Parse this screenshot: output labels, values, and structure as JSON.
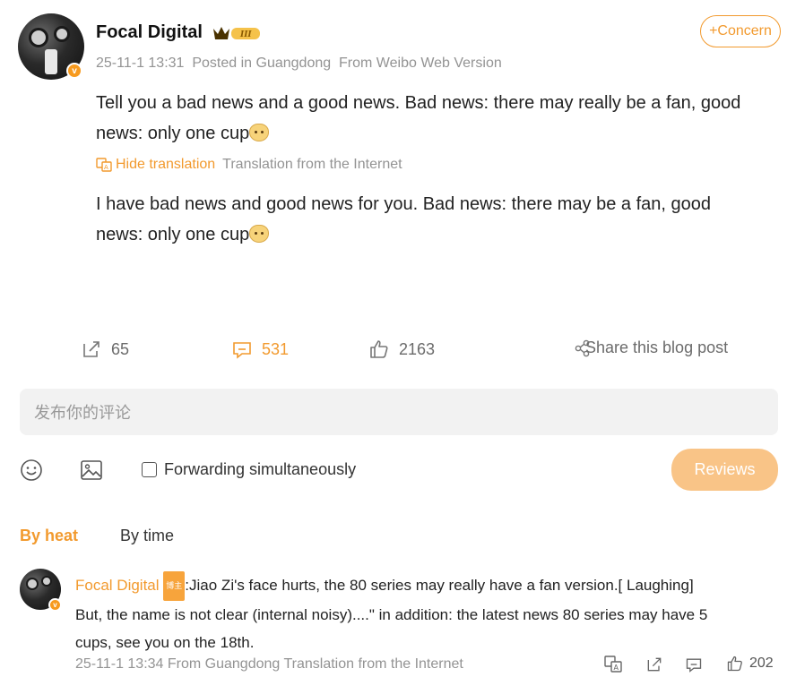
{
  "post": {
    "author": "Focal Digital",
    "timestamp": "25-11-1 13:31",
    "location": "Posted in Guangdong",
    "source": "From Weibo Web Version",
    "follow_label": "+Concern",
    "body_line1": "Tell you a bad news and a good news. Bad news: there may really be a fan, good",
    "body_line2": "news: only one cup",
    "hide_translation": "Hide translation",
    "translation_source": "Translation from the Internet",
    "translated_line1": "I have bad news and good news for you.  Bad news: there may be a fan, good",
    "translated_line2": "news: only one cup"
  },
  "actions": {
    "reposts": "65",
    "comments": "531",
    "likes": "2163",
    "share_label": "Share this blog post"
  },
  "composer": {
    "placeholder": "发布你的评论",
    "forward_label": "Forwarding simultaneously",
    "submit_label": "Reviews"
  },
  "sort": {
    "by_heat": "By heat",
    "by_time": "By time"
  },
  "comment": {
    "author": "Focal Digital",
    "tag": "博主",
    "text_line1": ":Jiao Zi's face hurts, the 80 series may really have a fan version.[ Laughing]",
    "text_line2": "But, the name is not clear (internal noisy)....\" in addition: the latest news 80 series may have 5",
    "text_line3": "cups, see you on the 18th.",
    "meta": "25-11-1 13:34 From Guangdong Translation from the Internet",
    "likes": "202"
  },
  "colors": {
    "accent": "#f29a2e",
    "reviews_button": "#f9c487",
    "input_bg": "#f2f2f2"
  }
}
